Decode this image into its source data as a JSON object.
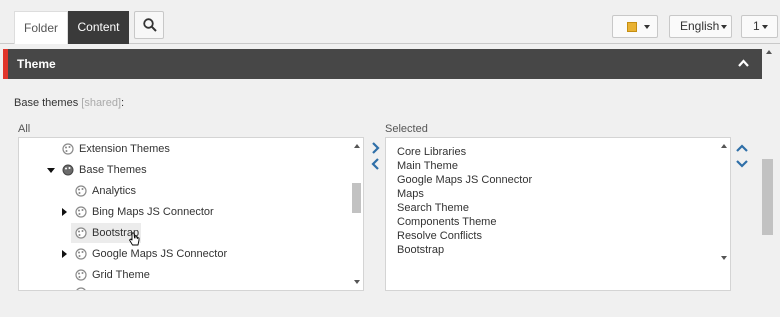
{
  "toolbar": {
    "tabs": [
      {
        "label": "Folder",
        "active": false
      },
      {
        "label": "Content",
        "active": true
      }
    ],
    "search_icon": "search-icon",
    "database_icon": "database-icon",
    "language": "English",
    "version": "1"
  },
  "section": {
    "title": "Theme",
    "collapse_icon": "chevron-up-icon"
  },
  "field": {
    "label": "Base themes",
    "shared_note": "[shared]",
    "colon": ":"
  },
  "lists": {
    "all_label": "All",
    "selected_label": "Selected"
  },
  "tree": [
    {
      "label": "Extension Themes",
      "icon": "theme-icon",
      "level": 1,
      "expander": "none"
    },
    {
      "label": "Base Themes",
      "icon": "theme-folder-icon",
      "level": 1,
      "expander": "expanded"
    },
    {
      "label": "Analytics",
      "icon": "theme-icon",
      "level": 2,
      "expander": "none"
    },
    {
      "label": "Bing Maps JS Connector",
      "icon": "theme-icon",
      "level": 2,
      "expander": "collapsed"
    },
    {
      "label": "Bootstrap",
      "icon": "theme-icon",
      "level": 2,
      "expander": "none",
      "highlighted": true
    },
    {
      "label": "Google Maps JS Connector",
      "icon": "theme-icon",
      "level": 2,
      "expander": "collapsed"
    },
    {
      "label": "Grid Theme",
      "icon": "theme-icon",
      "level": 2,
      "expander": "none"
    }
  ],
  "selected": [
    "Core Libraries",
    "Main Theme",
    "Google Maps JS Connector",
    "Maps",
    "Search Theme",
    "Components Theme",
    "Resolve Conflicts",
    "Bootstrap"
  ],
  "colors": {
    "accent_red": "#e0352b",
    "header_dark": "#474747",
    "tab_active": "#3a3a3a",
    "arrow_blue": "#2f6fa8"
  }
}
